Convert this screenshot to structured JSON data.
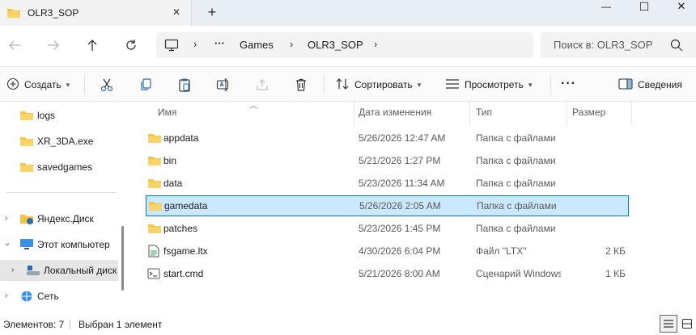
{
  "window": {
    "tab_title": "OLR3_SOP",
    "close_tab_glyph": "✕",
    "new_tab_glyph": "+",
    "minimize_glyph": "—",
    "maximize_glyph": "☐",
    "close_glyph": "✕"
  },
  "address": {
    "more_glyph": "···",
    "crumbs": [
      "Games",
      "OLR3_SOP"
    ],
    "search_placeholder": "Поиск в: OLR3_SOP"
  },
  "toolbar": {
    "new_label": "Создать",
    "sort_label": "Сортировать",
    "view_label": "Просмотреть",
    "more_glyph": "···",
    "details_label": "Сведения"
  },
  "navpane": {
    "quick": [
      {
        "label": "logs"
      },
      {
        "label": "XR_3DA.exe"
      },
      {
        "label": "savedgames"
      }
    ],
    "tree": [
      {
        "label": "Яндекс.Диск"
      },
      {
        "label": "Этот компьютер"
      },
      {
        "label": "Локальный диск"
      },
      {
        "label": "Сеть"
      }
    ]
  },
  "columns": {
    "name": "Имя",
    "date": "Дата изменения",
    "type": "Тип",
    "size": "Размер"
  },
  "files": [
    {
      "name": "appdata",
      "date": "5/26/2026 12:47 AM",
      "type": "Папка с файлами",
      "size": "",
      "icon": "folder-icon"
    },
    {
      "name": "bin",
      "date": "5/21/2026 1:27 PM",
      "type": "Папка с файлами",
      "size": "",
      "icon": "folder-icon"
    },
    {
      "name": "data",
      "date": "5/23/2026 11:34 AM",
      "type": "Папка с файлами",
      "size": "",
      "icon": "folder-icon"
    },
    {
      "name": "gamedata",
      "date": "5/26/2026 2:05 AM",
      "type": "Папка с файлами",
      "size": "",
      "icon": "folder-icon"
    },
    {
      "name": "patches",
      "date": "5/23/2026 1:45 PM",
      "type": "Папка с файлами",
      "size": "",
      "icon": "folder-icon"
    },
    {
      "name": "fsgame.ltx",
      "date": "4/30/2026 6:04 PM",
      "type": "Файл \"LTX\"",
      "size": "2 КБ",
      "icon": "text-file-icon"
    },
    {
      "name": "start.cmd",
      "date": "5/21/2026 8:00 AM",
      "type": "Сценарий Windows",
      "size": "1 КБ",
      "icon": "script-file-icon"
    }
  ],
  "selected_file": "gamedata",
  "status": {
    "count": "Элементов: 7",
    "selected": "Выбран 1 элемент"
  },
  "colors": {
    "folder": "#f4c542",
    "accent": "#0078d4",
    "selection": "#cce8ff"
  }
}
